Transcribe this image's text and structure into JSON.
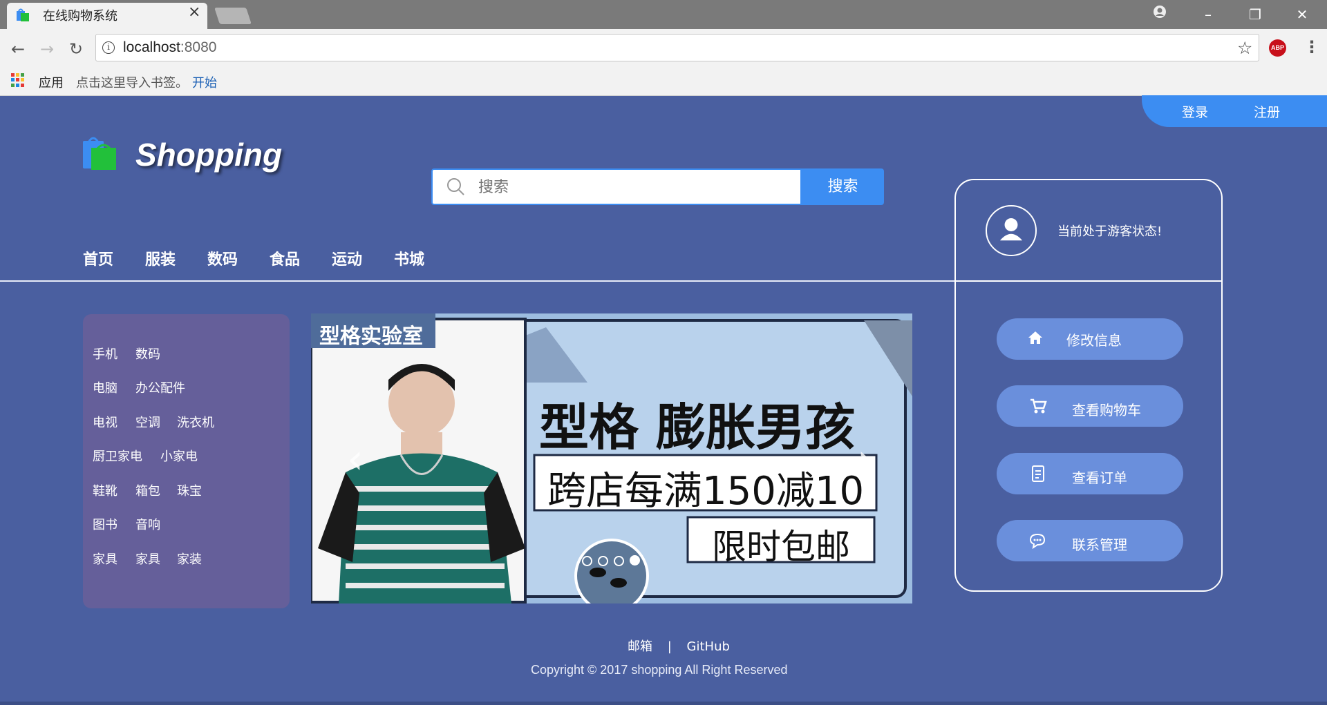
{
  "browser": {
    "tab_title": "在线购物系统",
    "tab_close": "×",
    "url_host": "localhost",
    "url_port": ":8080",
    "extension_label": "ABP",
    "bookmarks": {
      "apps_label": "应用",
      "hint": "点击这里导入书签。",
      "start_link": "开始"
    }
  },
  "header": {
    "login": "登录",
    "register": "注册",
    "logo_text": "Shopping",
    "search_placeholder": "搜索",
    "search_button": "搜索"
  },
  "nav": [
    "首页",
    "服装",
    "数码",
    "食品",
    "运动",
    "书城"
  ],
  "categories": [
    [
      "手机",
      "数码"
    ],
    [
      "电脑",
      "办公配件"
    ],
    [
      "电视",
      "空调",
      "洗衣机"
    ],
    [
      "厨卫家电",
      "小家电"
    ],
    [
      "鞋靴",
      "箱包",
      "珠宝"
    ],
    [
      "图书",
      "音响"
    ],
    [
      "家具",
      "家具",
      "家装"
    ]
  ],
  "banner": {
    "badge": "型格实验室",
    "headline": "型格 膨胀男孩",
    "promo1": "跨店每满150减10",
    "promo2": "限时包邮",
    "prev": "‹",
    "next": "›",
    "slide_count": 4,
    "active_slide": 4
  },
  "user_panel": {
    "status": "当前处于游客状态!",
    "actions": [
      {
        "label": "修改信息",
        "icon": "home-icon"
      },
      {
        "label": "查看购物车",
        "icon": "cart-icon"
      },
      {
        "label": "查看订单",
        "icon": "document-icon"
      },
      {
        "label": "联系管理",
        "icon": "chat-icon"
      }
    ]
  },
  "footer": {
    "email": "邮箱",
    "separator": "|",
    "github": "GitHub",
    "copyright": "Copyright © 2017 shopping All Right Reserved"
  },
  "colors": {
    "page_bg": "#4a5fa0",
    "accent": "#3c8df2",
    "category_bg": "#655f9a",
    "action_button": "#6a8fdc"
  }
}
